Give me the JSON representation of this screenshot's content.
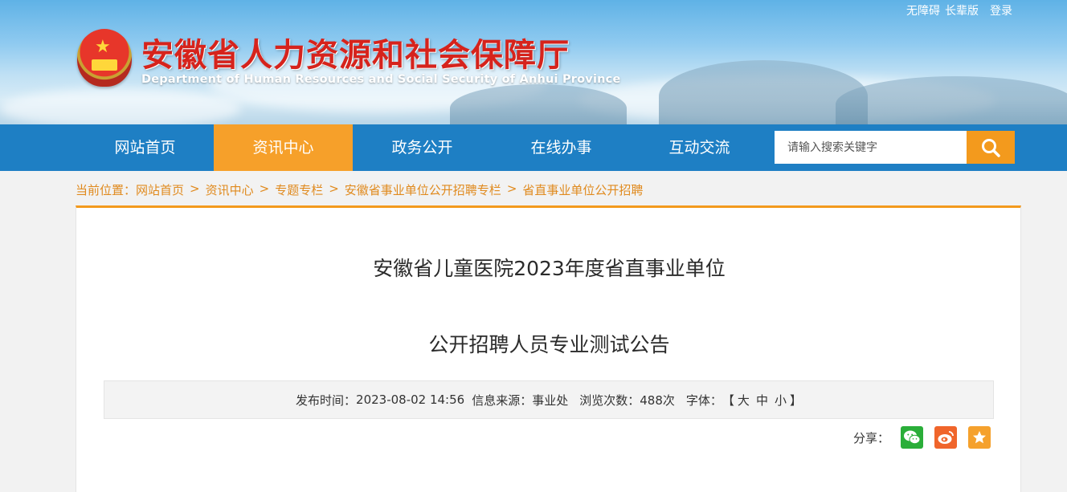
{
  "toplinks": {
    "accessible": "无障碍",
    "elder": "长辈版",
    "login": "登录"
  },
  "site": {
    "title_cn": "安徽省人力资源和社会保障厅",
    "title_en": "Department of Human Resources and Social Security of Anhui Province"
  },
  "nav": {
    "items": [
      {
        "label": "网站首页"
      },
      {
        "label": "资讯中心"
      },
      {
        "label": "政务公开"
      },
      {
        "label": "在线办事"
      },
      {
        "label": "互动交流"
      }
    ],
    "active_index": 1,
    "search_placeholder": "请输入搜索关键字"
  },
  "breadcrumb": {
    "prefix": "当前位置：",
    "items": [
      "网站首页",
      "资讯中心",
      "专题专栏",
      "安徽省事业单位公开招聘专栏",
      "省直事业单位公开招聘"
    ],
    "separator": ">"
  },
  "article": {
    "title_line1": "安徽省儿童医院2023年度省直事业单位",
    "title_line2": "公开招聘人员专业测试公告",
    "publish_label": "发布时间：",
    "publish_time": "2023-08-02 14:56",
    "source_label": "信息来源：",
    "source": "事业处",
    "views_label": "浏览次数：",
    "views": "488次",
    "font_label": "字体：",
    "font_open": "【",
    "font_large": "大",
    "font_medium": "中",
    "font_small": "小",
    "font_close": "】",
    "share_label": "分享："
  },
  "colors": {
    "nav_bg": "#1e7fc4",
    "accent_orange": "#f39a1d",
    "title_red": "#d6231c",
    "wechat_green": "#2aae39",
    "weibo_orange": "#f0652b",
    "favorite_orange": "#f5a12d"
  },
  "icons": {
    "search": "search-icon",
    "wechat": "wechat-icon",
    "weibo": "weibo-icon",
    "favorite": "favorite-star-icon",
    "emblem": "national-emblem-icon"
  }
}
